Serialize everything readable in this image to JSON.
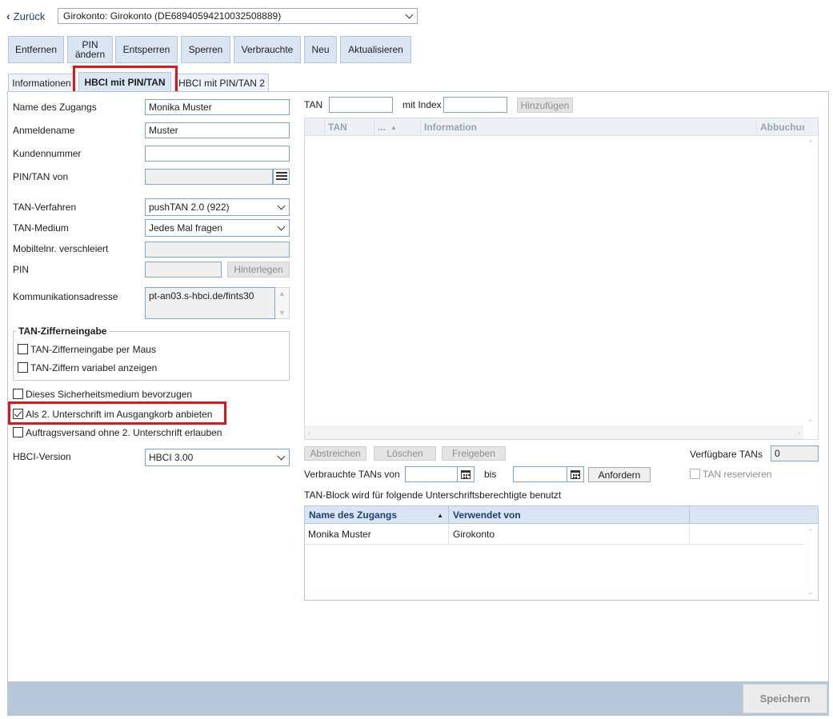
{
  "nav": {
    "back_label": "Zurück",
    "account_selected": "Girokonto: Girokonto (DE68940594210032508889)"
  },
  "toolbar": {
    "remove": "Entfernen",
    "change_pin_line1": "PIN",
    "change_pin_line2": "ändern",
    "unlock": "Entsperren",
    "lock": "Sperren",
    "used": "Verbrauchte",
    "new": "Neu",
    "refresh": "Aktualisieren"
  },
  "tabs": [
    "Informationen",
    "HBCI mit PIN/TAN",
    "HBCI mit PIN/TAN 2"
  ],
  "form": {
    "access_name_label": "Name des Zugangs",
    "access_name_value": "Monika Muster",
    "login_label": "Anmeldename",
    "login_value": "Muster",
    "customer_no_label": "Kundennummer",
    "customer_no_value": "",
    "pintan_from_label": "PIN/TAN von",
    "tan_method_label": "TAN-Verfahren",
    "tan_method_value": "pushTAN 2.0 (922)",
    "tan_medium_label": "TAN-Medium",
    "tan_medium_value": "Jedes Mal fragen",
    "mobile_label": "Mobiltelnr. verschleiert",
    "pin_label": "PIN",
    "deposit_button": "Hinterlegen",
    "comm_address_label": "Kommunikationsadresse",
    "comm_address_value": "pt-an03.s-hbci.de/fints30",
    "tan_digit_group": "TAN-Zifferneingabe",
    "tan_digit_mouse": "TAN-Zifferneingabe per Maus",
    "tan_digit_variable": "TAN-Ziffern variabel anzeigen",
    "prefer_medium": "Dieses Sicherheitsmedium bevorzugen",
    "second_signature": "Als 2. Unterschrift im Ausgangkorb anbieten",
    "order_without_second": "Auftragsversand ohne 2. Unterschrift erlauben",
    "hbci_version_label": "HBCI-Version",
    "hbci_version_value": "HBCI 3.00"
  },
  "tan_panel": {
    "tan_label": "TAN",
    "index_label": "mit Index",
    "add_button": "Hinzufügen",
    "grid_columns": [
      "TAN",
      "...",
      "Information",
      "Abbuchun"
    ],
    "cancel_button": "Abstreichen",
    "delete_button": "Löschen",
    "release_button": "Freigeben",
    "available_label": "Verfügbare TANs",
    "available_value": "0",
    "used_from_label": "Verbrauchte TANs von",
    "to_label": "bis",
    "request_button": "Anfordern",
    "reserve_label": "TAN reservieren",
    "block_caption": "TAN-Block wird für folgende Unterschriftsberechtigte benutzt",
    "users_columns": [
      "Name des Zugangs",
      "Verwendet von"
    ],
    "users_rows": [
      {
        "name": "Monika Muster",
        "used_by": "Girokonto"
      }
    ]
  },
  "footer": {
    "save": "Speichern"
  },
  "colors": {
    "accent": "#d9e5f2",
    "highlight": "#e3141c",
    "link": "#1d3f73"
  }
}
